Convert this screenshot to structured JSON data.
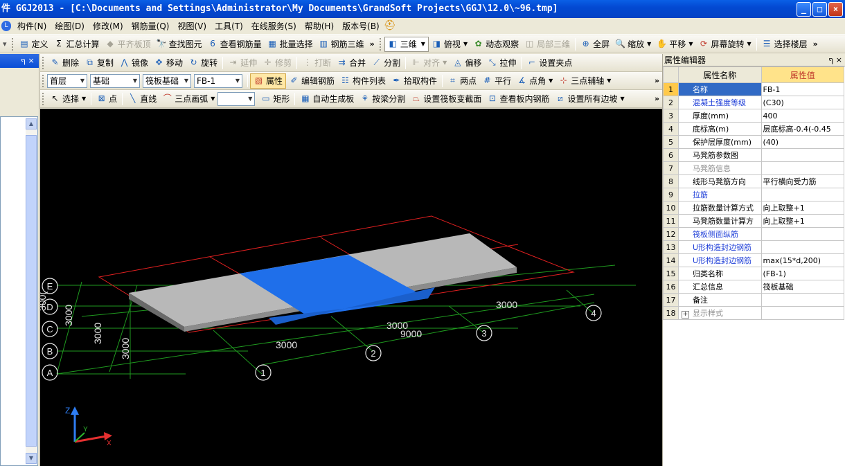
{
  "window": {
    "title": "件 GGJ2013 - [C:\\Documents and Settings\\Administrator\\My Documents\\GrandSoft Projects\\GGJ\\12.0\\~96.tmp]",
    "controls": [
      "_",
      "□",
      "×"
    ]
  },
  "menu": [
    "构件(N)",
    "绘图(D)",
    "修改(M)",
    "钢筋量(Q)",
    "视图(V)",
    "工具(T)",
    "在线服务(S)",
    "帮助(H)",
    "版本号(B)"
  ],
  "toolbar1": {
    "items": [
      "定义",
      "汇总计算",
      "平齐板顶",
      "查找图元",
      "查看钢筋量",
      "批量选择",
      "钢筋三维"
    ],
    "view_mode": "三维",
    "view_items": [
      "俯视",
      "动态观察",
      "局部三维",
      "全屏",
      "缩放",
      "平移",
      "屏幕旋转",
      "选择楼层"
    ]
  },
  "toolbar2": {
    "items": [
      "删除",
      "复制",
      "镜像",
      "移动",
      "旋转",
      "延伸",
      "修剪",
      "打断",
      "合并",
      "分割",
      "对齐",
      "偏移",
      "拉伸",
      "设置夹点"
    ]
  },
  "toolbar3": {
    "floor": "首层",
    "category": "基础",
    "type": "筏板基础",
    "component": "FB-1",
    "items": [
      "属性",
      "编辑钢筋",
      "构件列表",
      "拾取构件",
      "两点",
      "平行",
      "点角",
      "三点辅轴"
    ]
  },
  "toolbar4": {
    "items": [
      "选择",
      "点",
      "直线",
      "三点画弧",
      "矩形",
      "自动生成板",
      "按梁分割",
      "设置筏板变截面",
      "查看板内钢筋",
      "设置所有边坡"
    ]
  },
  "left_panel": {
    "pin": "ף ×"
  },
  "viewport": {
    "axis_labels_bottom": [
      "1",
      "2",
      "3",
      "4"
    ],
    "axis_labels_left": [
      "A",
      "B",
      "C",
      "D",
      "E"
    ],
    "dimensions_x": [
      "3000",
      "3000",
      "3000",
      "9000"
    ],
    "dimensions_y": [
      "3000",
      "3000",
      "3000",
      "300("
    ],
    "coord_axes": [
      "Z",
      "Y",
      "X"
    ]
  },
  "property_editor": {
    "title": "属性编辑器",
    "controls": "ף ×",
    "col_name": "属性名称",
    "col_value": "属性值",
    "rows": [
      {
        "idx": "1",
        "name": "名称",
        "value": "FB-1",
        "style": "sel"
      },
      {
        "idx": "2",
        "name": "混凝土强度等级",
        "value": "(C30)",
        "style": "blue"
      },
      {
        "idx": "3",
        "name": "厚度(mm)",
        "value": "400",
        "style": ""
      },
      {
        "idx": "4",
        "name": "底标高(m)",
        "value": "层底标高-0.4(-0.45",
        "style": ""
      },
      {
        "idx": "5",
        "name": "保护层厚度(mm)",
        "value": "(40)",
        "style": ""
      },
      {
        "idx": "6",
        "name": "马凳筋参数图",
        "value": "",
        "style": ""
      },
      {
        "idx": "7",
        "name": "马凳筋信息",
        "value": "",
        "style": "gray"
      },
      {
        "idx": "8",
        "name": "线形马凳筋方向",
        "value": "平行横向受力筋",
        "style": ""
      },
      {
        "idx": "9",
        "name": "拉筋",
        "value": "",
        "style": "blue"
      },
      {
        "idx": "10",
        "name": "拉筋数量计算方式",
        "value": "向上取整+1",
        "style": ""
      },
      {
        "idx": "11",
        "name": "马凳筋数量计算方",
        "value": "向上取整+1",
        "style": ""
      },
      {
        "idx": "12",
        "name": "筏板侧面纵筋",
        "value": "",
        "style": "blue"
      },
      {
        "idx": "13",
        "name": "U形构造封边钢筋",
        "value": "",
        "style": "blue"
      },
      {
        "idx": "14",
        "name": "U形构造封边钢筋",
        "value": "max(15*d,200)",
        "style": "blue"
      },
      {
        "idx": "15",
        "name": "归类名称",
        "value": "(FB-1)",
        "style": ""
      },
      {
        "idx": "16",
        "name": "汇总信息",
        "value": "筏板基础",
        "style": ""
      },
      {
        "idx": "17",
        "name": "备注",
        "value": "",
        "style": ""
      },
      {
        "idx": "18",
        "name": "显示样式",
        "value": "",
        "style": "gray"
      }
    ]
  }
}
